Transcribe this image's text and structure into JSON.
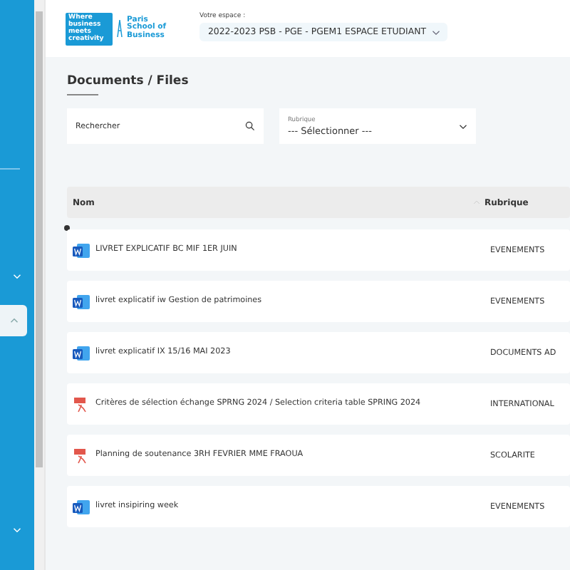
{
  "header": {
    "logo": {
      "tagline": "Where business meets creativity",
      "name": "Paris School of Business"
    },
    "space": {
      "label": "Votre espace :",
      "value": "2022-2023 PSB - PGE - PGEM1 ESPACE ETUDIANT"
    }
  },
  "page": {
    "title": "Documents / Files"
  },
  "filters": {
    "search": {
      "placeholder": "Rechercher"
    },
    "rubrique": {
      "label": "Rubrique",
      "value": "--- Sélectionner ---"
    }
  },
  "table": {
    "columns": [
      "Nom",
      "Rubrique"
    ],
    "rows": [
      {
        "kind": "word",
        "name": "LIVRET EXPLICATIF BC MIF 1ER JUIN",
        "rubrique": "EVENEMENTS"
      },
      {
        "kind": "word",
        "name": "livret explicatif iw Gestion de patrimoines",
        "rubrique": "EVENEMENTS"
      },
      {
        "kind": "word",
        "name": "livret explicatif IX 15/16 MAI 2023",
        "rubrique": "DOCUMENTS AD"
      },
      {
        "kind": "pdf",
        "name": "Critères de sélection échange SPRNG 2024 / Selection criteria table SPRING 2024",
        "rubrique": "INTERNATIONAL"
      },
      {
        "kind": "pdf",
        "name": "Planning de soutenance 3RH FEVRIER MME FRAOUA",
        "rubrique": "SCOLARITE"
      },
      {
        "kind": "word",
        "name": "livret insipiring week",
        "rubrique": "EVENEMENTS"
      }
    ]
  }
}
